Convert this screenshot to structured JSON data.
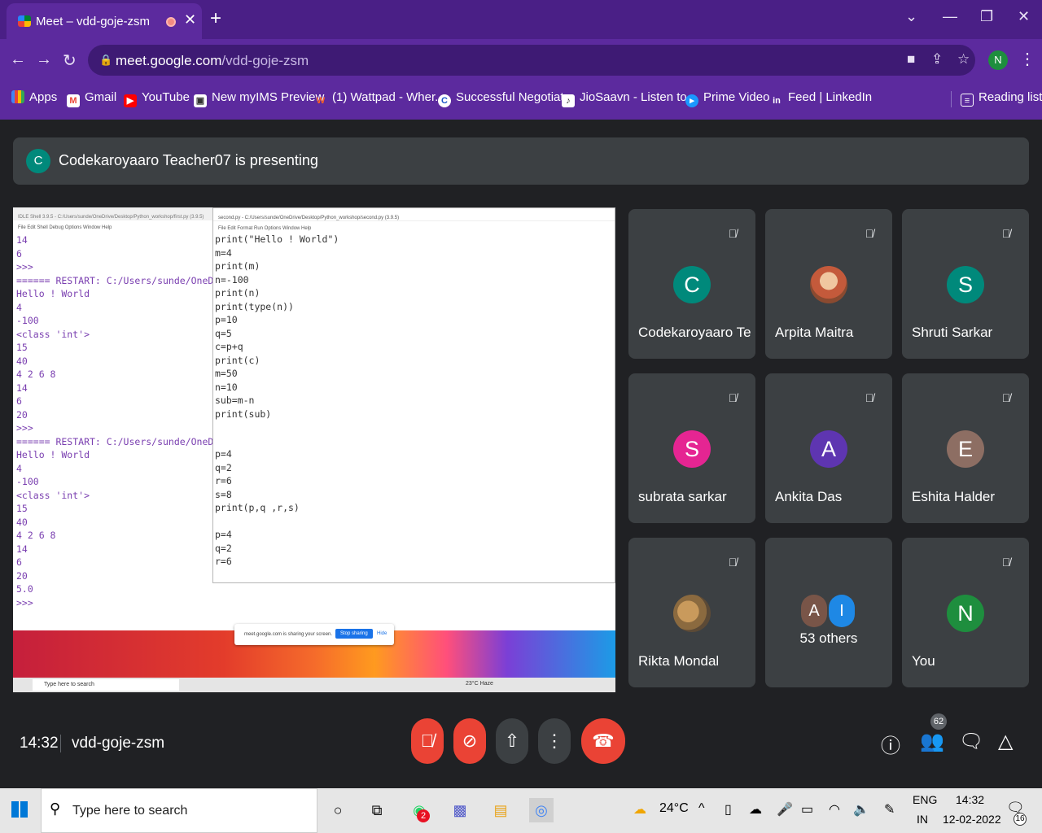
{
  "browser": {
    "tab_title": "Meet – vdd-goje-zsm",
    "tab_close": "✕",
    "new_tab": "+",
    "url_domain": "meet.google.com",
    "url_path": "/vdd-goje-zsm",
    "profile_initial": "N",
    "bookmarks": [
      {
        "label": "Apps"
      },
      {
        "label": "Gmail"
      },
      {
        "label": "YouTube"
      },
      {
        "label": "New myIMS Preview"
      },
      {
        "label": "(1) Wattpad - Wher..."
      },
      {
        "label": "Successful Negotiat..."
      },
      {
        "label": "JioSaavn - Listen to..."
      },
      {
        "label": "Prime Video"
      },
      {
        "label": "Feed | LinkedIn"
      }
    ],
    "reading_list": "Reading list"
  },
  "meet": {
    "presenter_initial": "C",
    "presenting_text": "Codekaroyaaro Teacher07 is presenting",
    "shell_output": "14\n6\n>>>\n====== RESTART: C:/Users/sunde/OneDrive\nHello ! World\n4\n-100\n<class 'int'>\n15\n40\n4 2 6 8\n14\n6\n20\n>>>\n====== RESTART: C:/Users/sunde/OneDrive\nHello ! World\n4\n-100\n<class 'int'>\n15\n40\n4 2 6 8\n14\n6\n20\n5.0\n>>>",
    "editor_title": "second.py - C:/Users/sunde/OneDrive/Desktop/Python_workshop/second.py (3.9.5)",
    "shell_title": "IDLE Shell 3.9.5 - C:/Users/sunde/OneDrive/Desktop/Python_workshop/first.py (3.9.5)",
    "menu_items": "File  Edit  Shell  Debug  Options  Window  Help",
    "editor_menu": "File  Edit  Format  Run  Options  Window  Help",
    "editor_code": "print(\"Hello ! World\")\nm=4\nprint(m)\nn=-100\nprint(n)\nprint(type(n))\np=10\nq=5\nc=p+q\nprint(c)\nm=50\nn=10\nsub=m-n\nprint(sub)\n\n\np=4\nq=2\nr=6\ns=8\nprint(p,q ,r,s)\n\np=4\nq=2\nr=6",
    "share_msg": "meet.google.com is sharing your screen.",
    "stop_sharing": "Stop sharing",
    "hide": "Hide",
    "inner_search": "Type here to search",
    "inner_weather": "23°C Haze",
    "participants": [
      {
        "name": "Codekaroyaaro Te...",
        "initial": "C",
        "color": "#00897b"
      },
      {
        "name": "Arpita Maitra",
        "initial": "",
        "color": "#8a4a30"
      },
      {
        "name": "Shruti Sarkar",
        "initial": "S",
        "color": "#00897b"
      },
      {
        "name": "subrata sarkar",
        "initial": "S",
        "color": "#e52592"
      },
      {
        "name": "Ankita Das",
        "initial": "A",
        "color": "#5e35b1"
      },
      {
        "name": "Eshita Halder",
        "initial": "E",
        "color": "#8d6e63"
      },
      {
        "name": "Rikta Mondal",
        "initial": "",
        "color": "#5c4a36"
      },
      {
        "name": "You",
        "initial": "N",
        "color": "#1e8e3e"
      }
    ],
    "others_label": "53 others",
    "others_avatars": [
      {
        "initial": "A",
        "color": "#795548"
      },
      {
        "initial": "I",
        "color": "#1e88e5"
      }
    ],
    "clock": "14:32",
    "meeting_code": "vdd-goje-zsm",
    "participant_count": "62"
  },
  "taskbar": {
    "search_placeholder": "Type here to search",
    "weather": "24°C",
    "lang_top": "ENG",
    "lang_bottom": "IN",
    "time": "14:32",
    "date": "12-02-2022",
    "notif_count": "16",
    "whatsapp_badge": "2"
  }
}
